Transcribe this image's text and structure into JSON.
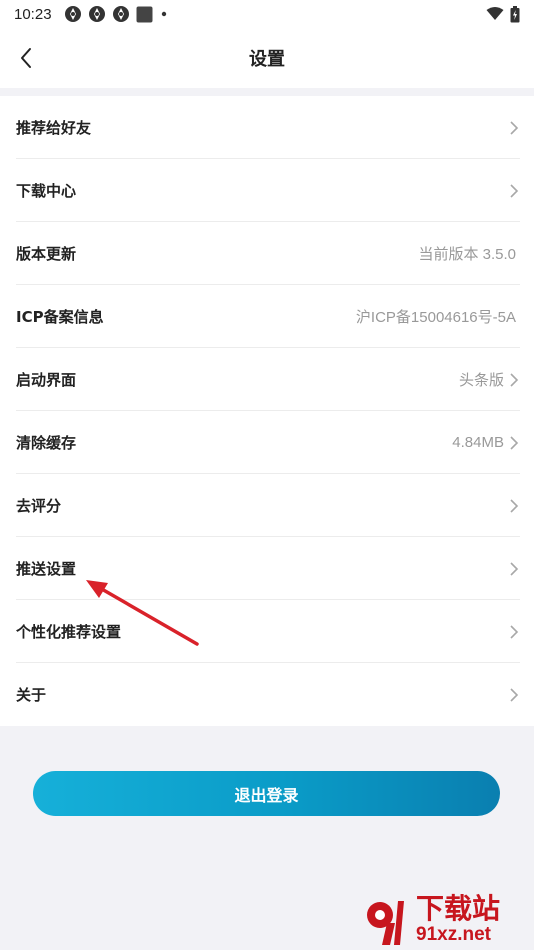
{
  "status_bar": {
    "time": "10:23",
    "icons": [
      "aperture-icon",
      "aperture-icon",
      "aperture-icon",
      "app-square-icon",
      "dot-icon"
    ],
    "right_icons": [
      "wifi-icon",
      "battery-icon"
    ]
  },
  "header": {
    "title": "设置",
    "back_icon": "chevron-left-icon"
  },
  "settings": {
    "items": [
      {
        "label": "推荐给好友",
        "value": "",
        "chevron": true
      },
      {
        "label": "下载中心",
        "value": "",
        "chevron": true
      },
      {
        "label": "版本更新",
        "value": "当前版本 3.5.0",
        "chevron": false
      },
      {
        "label": "ICP备案信息",
        "value": "沪ICP备15004616号-5A",
        "chevron": false
      },
      {
        "label": "启动界面",
        "value": "头条版",
        "chevron": true
      },
      {
        "label": "清除缓存",
        "value": "4.84MB",
        "chevron": true
      },
      {
        "label": "去评分",
        "value": "",
        "chevron": true
      },
      {
        "label": "推送设置",
        "value": "",
        "chevron": true
      },
      {
        "label": "个性化推荐设置",
        "value": "",
        "chevron": true
      },
      {
        "label": "关于",
        "value": "",
        "chevron": true
      }
    ]
  },
  "logout_button": {
    "label": "退出登录"
  },
  "watermark": {
    "title": "下载站",
    "url": "91xz.net"
  },
  "colors": {
    "accent_start": "#16b0d9",
    "accent_end": "#0a7fb0",
    "annotation_arrow": "#d9222a",
    "watermark": "#c7161e",
    "background": "#f2f2f6"
  }
}
